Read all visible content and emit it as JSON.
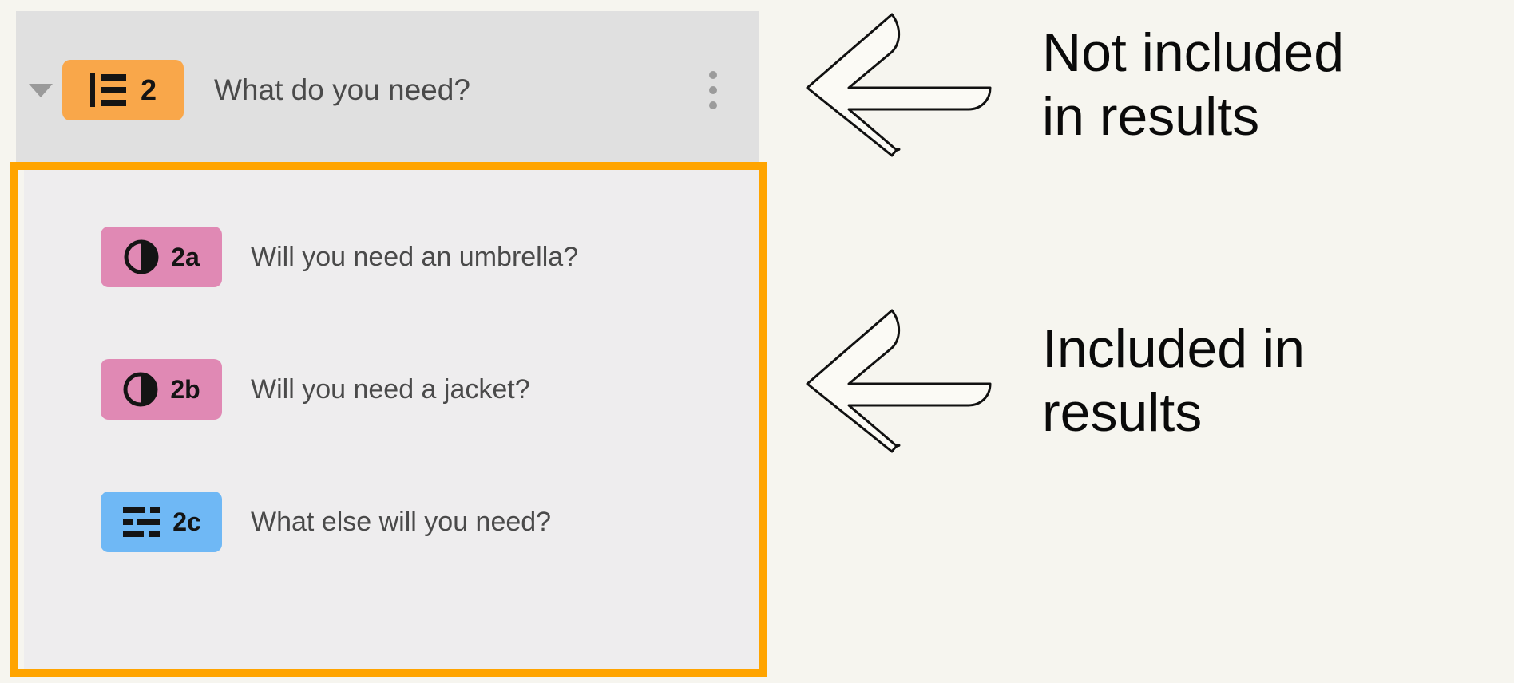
{
  "section": {
    "code": "2",
    "title": "What do you need?",
    "badge_color": "#f9a74a",
    "icon": "section-list-icon",
    "caret": "collapse-caret-down",
    "menu": "kebab-menu-icon",
    "expanded": true
  },
  "questions": [
    {
      "code": "2a",
      "text": "Will you need an umbrella?",
      "type": "binary",
      "icon": "half-filled-circle-icon",
      "badge_color": "#e089b4"
    },
    {
      "code": "2b",
      "text": "Will you need a jacket?",
      "type": "binary",
      "icon": "half-filled-circle-icon",
      "badge_color": "#e089b4"
    },
    {
      "code": "2c",
      "text": "What else will you need?",
      "type": "text",
      "icon": "text-lines-icon",
      "badge_color": "#6fb8f5"
    }
  ],
  "highlight": {
    "border_color": "#ffa400"
  },
  "annotations": [
    {
      "icon": "arrow-left-icon",
      "caption": "Not included\nin results",
      "target": "section-header"
    },
    {
      "icon": "arrow-left-icon",
      "caption": "Included in\nresults",
      "target": "question-list"
    }
  ],
  "colors": {
    "page_background": "#f6f5ef",
    "header_background": "#e0e0e0",
    "list_background": "#eeedee",
    "text": "#4a4a4a",
    "accent_orange": "#ffa400"
  }
}
